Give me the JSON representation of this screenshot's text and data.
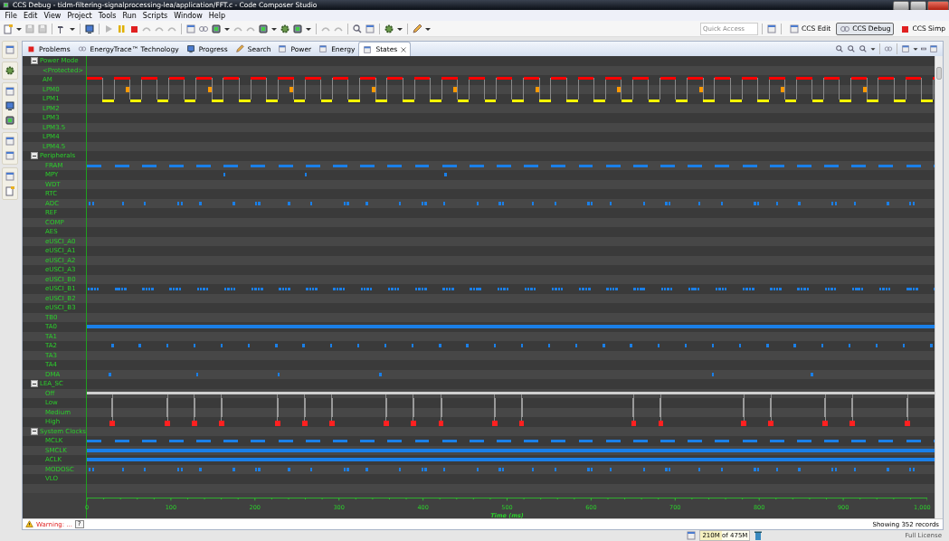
{
  "window": {
    "title": "CCS Debug - tidm-filtering-signalprocessing-lea/application/FFT.c - Code Composer Studio"
  },
  "menu": [
    "File",
    "Edit",
    "View",
    "Project",
    "Tools",
    "Run",
    "Scripts",
    "Window",
    "Help"
  ],
  "toolbar": {
    "quick_access": {
      "placeholder": "Quick Access"
    },
    "perspectives": [
      {
        "label": "CCS Edit",
        "selected": false
      },
      {
        "label": "CCS Debug",
        "selected": true
      },
      {
        "label": "CCS Simp",
        "selected": false
      }
    ]
  },
  "tabs": [
    {
      "label": "Problems",
      "selected": false
    },
    {
      "label": "EnergyTrace™ Technology",
      "selected": false
    },
    {
      "label": "Progress",
      "selected": false
    },
    {
      "label": "Search",
      "selected": false
    },
    {
      "label": "Power",
      "selected": false
    },
    {
      "label": "Energy",
      "selected": false
    },
    {
      "label": "States",
      "selected": true
    }
  ],
  "states": {
    "groups": [
      {
        "label": "Power Mode",
        "expanded": true,
        "rows": [
          {
            "label": "<Protected>",
            "kind": "none"
          },
          {
            "label": "AM",
            "kind": "active",
            "color": "#ff0000"
          },
          {
            "label": "LPM0",
            "kind": "transition",
            "color": "#ff9900"
          },
          {
            "label": "LPM1",
            "kind": "sleep",
            "color": "#ffff00"
          },
          {
            "label": "LPM2",
            "kind": "none"
          },
          {
            "label": "LPM3",
            "kind": "none"
          },
          {
            "label": "LPM3.5",
            "kind": "none"
          },
          {
            "label": "LPM4",
            "kind": "none"
          },
          {
            "label": "LPM4.5",
            "kind": "none"
          }
        ]
      },
      {
        "label": "Peripherals",
        "expanded": true,
        "rows": [
          {
            "label": "FRAM",
            "kind": "periodic",
            "color": "#1a7fe8"
          },
          {
            "label": "MPY",
            "kind": "rare",
            "color": "#1a7fe8"
          },
          {
            "label": "WDT",
            "kind": "none"
          },
          {
            "label": "RTC",
            "kind": "none"
          },
          {
            "label": "ADC",
            "kind": "jitter",
            "color": "#1a7fe8"
          },
          {
            "label": "REF",
            "kind": "none"
          },
          {
            "label": "COMP",
            "kind": "none"
          },
          {
            "label": "AES",
            "kind": "none"
          },
          {
            "label": "eUSCI_A0",
            "kind": "none"
          },
          {
            "label": "eUSCI_A1",
            "kind": "none"
          },
          {
            "label": "eUSCI_A2",
            "kind": "none"
          },
          {
            "label": "eUSCI_A3",
            "kind": "none"
          },
          {
            "label": "eUSCI_B0",
            "kind": "none"
          },
          {
            "label": "eUSCI_B1",
            "kind": "burst",
            "color": "#1a7fe8"
          },
          {
            "label": "eUSCI_B2",
            "kind": "none"
          },
          {
            "label": "eUSCI_B3",
            "kind": "none"
          },
          {
            "label": "TB0",
            "kind": "none"
          },
          {
            "label": "TA0",
            "kind": "solid",
            "color": "#1a7fe8"
          },
          {
            "label": "TA1",
            "kind": "none"
          },
          {
            "label": "TA2",
            "kind": "timer",
            "color": "#1a7fe8"
          },
          {
            "label": "TA3",
            "kind": "none"
          },
          {
            "label": "TA4",
            "kind": "none"
          },
          {
            "label": "DMA",
            "kind": "scattered",
            "color": "#1a7fe8"
          }
        ]
      },
      {
        "label": "LEA_SC",
        "expanded": true,
        "rows": [
          {
            "label": "Off",
            "kind": "off-level",
            "color": "#cfcfcf"
          },
          {
            "label": "Low",
            "kind": "spike-line",
            "color": "#9a9a9a"
          },
          {
            "label": "Medium",
            "kind": "spike-line",
            "color": "#9a9a9a"
          },
          {
            "label": "High",
            "kind": "spike-end",
            "color": "#ff2020"
          }
        ]
      },
      {
        "label": "System Clocks",
        "expanded": true,
        "rows": [
          {
            "label": "MCLK",
            "kind": "periodic",
            "color": "#1a7fe8"
          },
          {
            "label": "SMCLK",
            "kind": "solid",
            "color": "#1a7fe8"
          },
          {
            "label": "ACLK",
            "kind": "solid",
            "color": "#1a7fe8"
          },
          {
            "label": "MODOSC",
            "kind": "jitter",
            "color": "#1a7fe8"
          },
          {
            "label": "VLO",
            "kind": "none"
          }
        ]
      }
    ],
    "axis": {
      "labels": [
        "0",
        "100",
        "200",
        "300",
        "400",
        "500",
        "600",
        "700",
        "800",
        "900",
        "1,000"
      ],
      "title": "Time (ms)"
    }
  },
  "view_status": {
    "warning": "Warning: ...",
    "help": "?",
    "records": "Showing 352 records"
  },
  "status_bar": {
    "memory": "210M of 475M",
    "level": 0.44,
    "license": "Full License"
  }
}
